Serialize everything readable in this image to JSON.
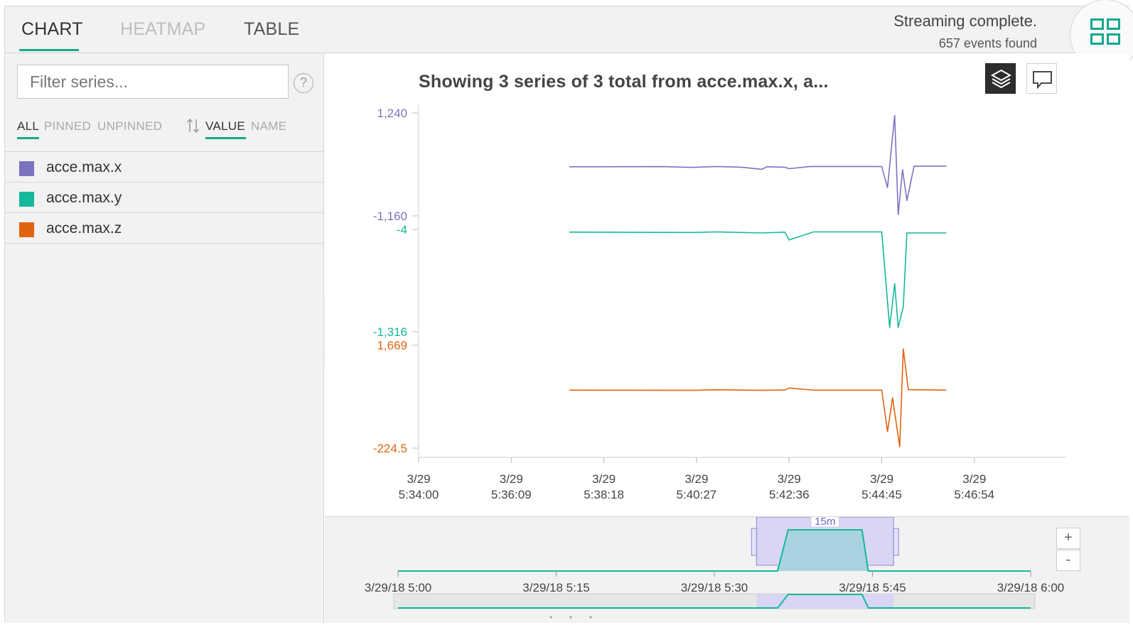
{
  "tabs": [
    {
      "label": "CHART",
      "active": true
    },
    {
      "label": "HEATMAP",
      "active": false
    },
    {
      "label": "TABLE",
      "active": false
    }
  ],
  "status": {
    "title": "Streaming complete.",
    "count": "657 events found"
  },
  "sidebar": {
    "filter_placeholder": "Filter series...",
    "help_label": "?",
    "filters": [
      "ALL",
      "PINNED",
      "UNPINNED"
    ],
    "sort": [
      "VALUE",
      "NAME"
    ],
    "series": [
      {
        "name": "acce.max.x",
        "color": "#7b72c0"
      },
      {
        "name": "acce.max.y",
        "color": "#14b89a"
      },
      {
        "name": "acce.max.z",
        "color": "#e06410"
      }
    ]
  },
  "chart_data": {
    "type": "line",
    "title": "Showing 3 series of 3 total from acce.max.x, a...",
    "x_ticks": [
      [
        "3/29",
        "5:34:00"
      ],
      [
        "3/29",
        "5:36:09"
      ],
      [
        "3/29",
        "5:38:18"
      ],
      [
        "3/29",
        "5:40:27"
      ],
      [
        "3/29",
        "5:42:36"
      ],
      [
        "3/29",
        "5:44:45"
      ],
      [
        "3/29",
        "5:46:54"
      ]
    ],
    "x_tick_times": [
      "05:34:00",
      "05:36:09",
      "05:38:18",
      "05:40:27",
      "05:42:36",
      "05:44:45",
      "05:46:54"
    ],
    "series": [
      {
        "name": "acce.max.x",
        "color": "#7b72c0",
        "axis_labels": [
          "1,240",
          "-1,160"
        ],
        "range": [
          -1160,
          1240
        ],
        "points": [
          [
            "05:37:30",
            -15
          ],
          [
            "05:39:40",
            -12
          ],
          [
            "05:40:20",
            -30
          ],
          [
            "05:40:55",
            -10
          ],
          [
            "05:41:30",
            -25
          ],
          [
            "05:41:58",
            -75
          ],
          [
            "05:42:05",
            -15
          ],
          [
            "05:42:30",
            -25
          ],
          [
            "05:42:36",
            -60
          ],
          [
            "05:43:05",
            -8
          ],
          [
            "05:44:30",
            -8
          ],
          [
            "05:44:45",
            -12
          ],
          [
            "05:44:53",
            -500
          ],
          [
            "05:45:03",
            1180
          ],
          [
            "05:45:08",
            -1130
          ],
          [
            "05:45:14",
            -80
          ],
          [
            "05:45:20",
            -800
          ],
          [
            "05:45:30",
            0
          ],
          [
            "05:46:15",
            0
          ]
        ]
      },
      {
        "name": "acce.max.y",
        "color": "#14b89a",
        "axis_labels": [
          "-4",
          "-1,316"
        ],
        "range": [
          -1316,
          -4
        ],
        "points": [
          [
            "05:37:30",
            -39
          ],
          [
            "05:40:20",
            -43
          ],
          [
            "05:40:55",
            -36
          ],
          [
            "05:41:58",
            -50
          ],
          [
            "05:42:30",
            -39
          ],
          [
            "05:42:36",
            -140
          ],
          [
            "05:43:10",
            -36
          ],
          [
            "05:44:30",
            -36
          ],
          [
            "05:44:45",
            -36
          ],
          [
            "05:44:56",
            -1260
          ],
          [
            "05:45:03",
            -700
          ],
          [
            "05:45:08",
            -1260
          ],
          [
            "05:45:15",
            -1000
          ],
          [
            "05:45:20",
            -50
          ],
          [
            "05:46:15",
            -50
          ]
        ]
      },
      {
        "name": "acce.max.z",
        "color": "#e06410",
        "axis_labels": [
          "1,669",
          "-224.5"
        ],
        "range": [
          -224.5,
          1669
        ],
        "points": [
          [
            "05:37:30",
            842
          ],
          [
            "05:40:20",
            838
          ],
          [
            "05:40:55",
            849
          ],
          [
            "05:41:58",
            838
          ],
          [
            "05:42:30",
            845
          ],
          [
            "05:42:36",
            882
          ],
          [
            "05:43:10",
            842
          ],
          [
            "05:44:30",
            842
          ],
          [
            "05:44:45",
            842
          ],
          [
            "05:44:53",
            80
          ],
          [
            "05:45:00",
            700
          ],
          [
            "05:45:10",
            -200
          ],
          [
            "05:45:15",
            1600
          ],
          [
            "05:45:22",
            850
          ],
          [
            "05:46:15",
            842
          ]
        ]
      }
    ]
  },
  "navigator": {
    "ticks": [
      "3/29/18 5:00",
      "3/29/18 5:15",
      "3/29/18 5:30",
      "3/29/18 5:45",
      "3/29/18 6:00"
    ],
    "tick_times": [
      "05:00",
      "05:15",
      "05:30",
      "05:45",
      "06:00"
    ],
    "window": [
      "05:34",
      "05:47"
    ],
    "window_label": "15m",
    "activity": [
      [
        "05:00",
        0
      ],
      [
        "05:36",
        0
      ],
      [
        "05:37",
        1
      ],
      [
        "05:44",
        1
      ],
      [
        "05:44.6",
        0
      ],
      [
        "06:00",
        0
      ]
    ],
    "zoom_in": "+",
    "zoom_out": "-",
    "accent": "#14b89a",
    "window_color": "#d8d6f3"
  }
}
